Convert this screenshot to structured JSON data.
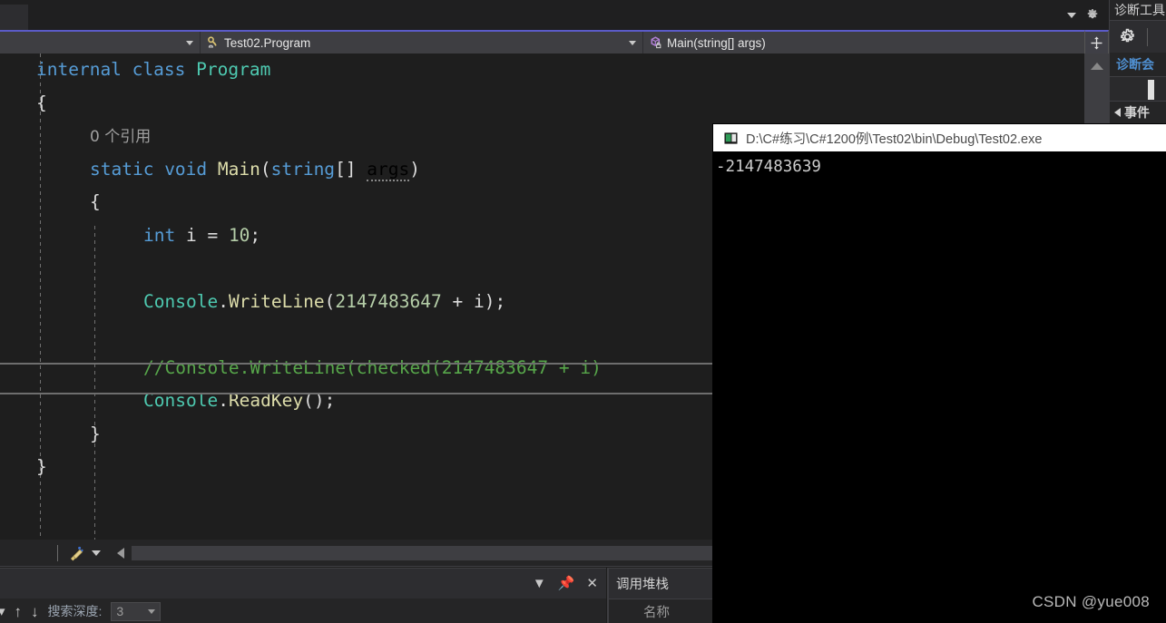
{
  "window": {
    "top_right_icons": [
      "chevron-down-icon",
      "gear-icon"
    ]
  },
  "navbar": {
    "project_combo": {
      "value": "",
      "icon": "chevron-down-icon"
    },
    "type_combo": {
      "value": "Test02.Program",
      "icon": "class-icon"
    },
    "member_combo": {
      "value": "Main(string[] args)",
      "icon": "method-icon"
    },
    "split_button": {
      "icon": "split-editor-icon"
    }
  },
  "editor": {
    "lines": [
      {
        "indent": 0,
        "tokens": [
          {
            "t": "internal ",
            "c": "kw"
          },
          {
            "t": "class ",
            "c": "kw"
          },
          {
            "t": "Program",
            "c": "cls"
          }
        ]
      },
      {
        "indent": 0,
        "tokens": [
          {
            "t": "{",
            "c": "pun"
          }
        ]
      },
      {
        "indent": 1,
        "tokens": [
          {
            "t": "0 个引用",
            "c": "lens"
          }
        ]
      },
      {
        "indent": 1,
        "tokens": [
          {
            "t": "static ",
            "c": "kw"
          },
          {
            "t": "void ",
            "c": "kw"
          },
          {
            "t": "Main",
            "c": "fn"
          },
          {
            "t": "(",
            "c": "pun"
          },
          {
            "t": "string",
            "c": "kw"
          },
          {
            "t": "[] ",
            "c": "pun"
          },
          {
            "t": "args",
            "c": "sq"
          },
          {
            "t": ")",
            "c": "pun"
          }
        ]
      },
      {
        "indent": 1,
        "tokens": [
          {
            "t": "{",
            "c": "pun"
          }
        ]
      },
      {
        "indent": 2,
        "tokens": [
          {
            "t": "int ",
            "c": "kw"
          },
          {
            "t": "i ",
            "c": "pln"
          },
          {
            "t": "= ",
            "c": "pun"
          },
          {
            "t": "10",
            "c": "num"
          },
          {
            "t": ";",
            "c": "pun"
          }
        ]
      },
      {
        "indent": 2,
        "tokens": []
      },
      {
        "indent": 2,
        "tokens": [
          {
            "t": "Console",
            "c": "typ"
          },
          {
            "t": ".",
            "c": "pun"
          },
          {
            "t": "WriteLine",
            "c": "fn"
          },
          {
            "t": "(",
            "c": "pun"
          },
          {
            "t": "2147483647",
            "c": "num"
          },
          {
            "t": " + ",
            "c": "pun"
          },
          {
            "t": "i",
            "c": "pln"
          },
          {
            "t": ");",
            "c": "pun"
          }
        ]
      },
      {
        "indent": 2,
        "tokens": []
      },
      {
        "indent": 2,
        "tokens": [
          {
            "t": "//Console.WriteLine(checked(2147483647 + i)",
            "c": "grn"
          }
        ]
      },
      {
        "indent": 2,
        "tokens": [
          {
            "t": "Console",
            "c": "typ"
          },
          {
            "t": ".",
            "c": "pun"
          },
          {
            "t": "ReadKey",
            "c": "fn"
          },
          {
            "t": "();",
            "c": "pun"
          }
        ]
      },
      {
        "indent": 1,
        "tokens": [
          {
            "t": "}",
            "c": "pun"
          }
        ]
      },
      {
        "indent": 0,
        "tokens": [
          {
            "t": "}",
            "c": "pun"
          }
        ]
      }
    ],
    "scroll_up_icon": "scroll-up-arrow-icon"
  },
  "editor_scrollbar": {
    "brush_icon": "brush-icon",
    "brush_caret_icon": "chevron-down-icon",
    "left_arrow_icon": "scroll-left-arrow-icon"
  },
  "bottom_left_panel": {
    "header_icons": [
      "chevron-down-icon",
      "pin-icon",
      "close-icon"
    ],
    "toolbar": {
      "filter_caret_icon": "chevron-down-icon",
      "up_icon": "arrow-up-icon",
      "down_icon": "arrow-down-icon",
      "depth_label": "搜索深度:",
      "depth_value": "3"
    }
  },
  "call_stack_panel": {
    "title": "调用堆栈",
    "column_name": "名称"
  },
  "diagnostic_tools": {
    "title": "诊断工具",
    "gear_icon": "gear-icon",
    "session_label": "诊断会",
    "events_label": "事件",
    "events_expander_icon": "triangle-right-icon"
  },
  "console_window": {
    "icon": "console-app-icon",
    "title": "D:\\C#练习\\C#1200例\\Test02\\bin\\Debug\\Test02.exe",
    "output": "-2147483639"
  },
  "watermark": {
    "text": "CSDN @yue008"
  },
  "colors": {
    "editor_bg": "#1e1e1e",
    "chrome_bg": "#2d2d30",
    "navbar_bg": "#3e3e42",
    "accent_purple": "#5b5bc8",
    "keyword_blue": "#569cd6",
    "type_teal": "#4ec9b0",
    "method_yellow": "#dcdcaa",
    "comment_green": "#57a64a",
    "number_green": "#b5cea8",
    "console_title_bg": "#ffffff",
    "diag_link_blue": "#4f8fd0"
  }
}
